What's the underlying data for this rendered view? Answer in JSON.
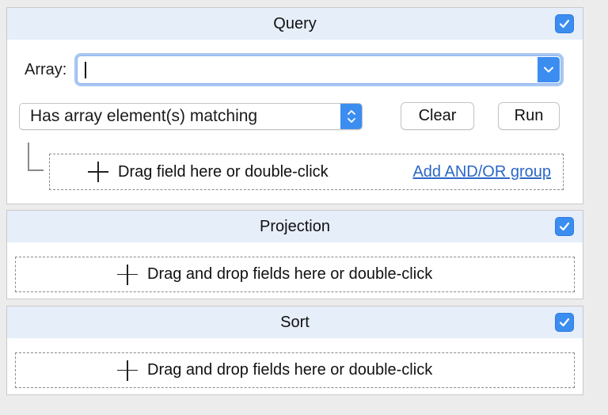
{
  "query": {
    "title": "Query",
    "checked": true,
    "array_label": "Array:",
    "array_value": "",
    "operator_selected": "Has array element(s) matching",
    "clear_label": "Clear",
    "run_label": "Run",
    "dropzone_text": "Drag field here or double-click",
    "add_group_label": "Add AND/OR group"
  },
  "projection": {
    "title": "Projection",
    "checked": true,
    "dropzone_text": "Drag and drop fields here or double-click"
  },
  "sort": {
    "title": "Sort",
    "checked": true,
    "dropzone_text": "Drag and drop fields here or double-click"
  },
  "colors": {
    "accent": "#3c8df0",
    "header_bg": "#e6eefa",
    "link": "#2b67c8"
  },
  "icons": {
    "checkbox": "checkmark-icon",
    "combo": "chevron-down-icon",
    "select": "up-down-chevron-icon",
    "dropzone": "plus-icon"
  }
}
